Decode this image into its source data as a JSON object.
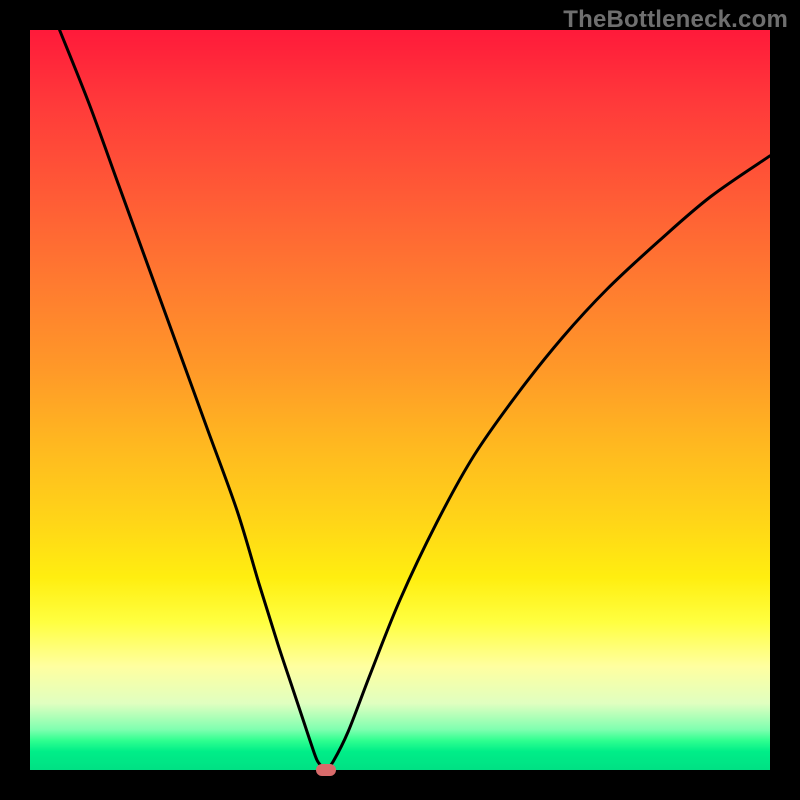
{
  "watermark": {
    "text": "TheBottleneck.com"
  },
  "chart_data": {
    "type": "line",
    "title": "",
    "xlabel": "",
    "ylabel": "",
    "xlim": [
      0,
      100
    ],
    "ylim": [
      0,
      100
    ],
    "series": [
      {
        "name": "bottleneck-curve",
        "x": [
          4,
          8,
          12,
          16,
          20,
          24,
          28,
          31,
          33.5,
          35.5,
          37,
          38,
          38.8,
          39.6,
          40,
          41,
          43,
          46,
          50,
          55,
          60,
          66,
          72,
          78,
          85,
          92,
          100
        ],
        "values": [
          100,
          90,
          79,
          68,
          57,
          46,
          35,
          25,
          17,
          11,
          6.5,
          3.5,
          1.3,
          0.3,
          0,
          1.2,
          5.2,
          13,
          23,
          33.5,
          42.5,
          51,
          58.5,
          65,
          71.5,
          77.5,
          83
        ]
      }
    ],
    "marker": {
      "x": 40,
      "y": 0
    },
    "background_gradient": {
      "top": "#ff1a3a",
      "mid": "#ffee10",
      "bottom": "#00e084"
    },
    "colors": {
      "curve": "#000000",
      "marker": "#d86a6a",
      "frame": "#000000"
    }
  }
}
